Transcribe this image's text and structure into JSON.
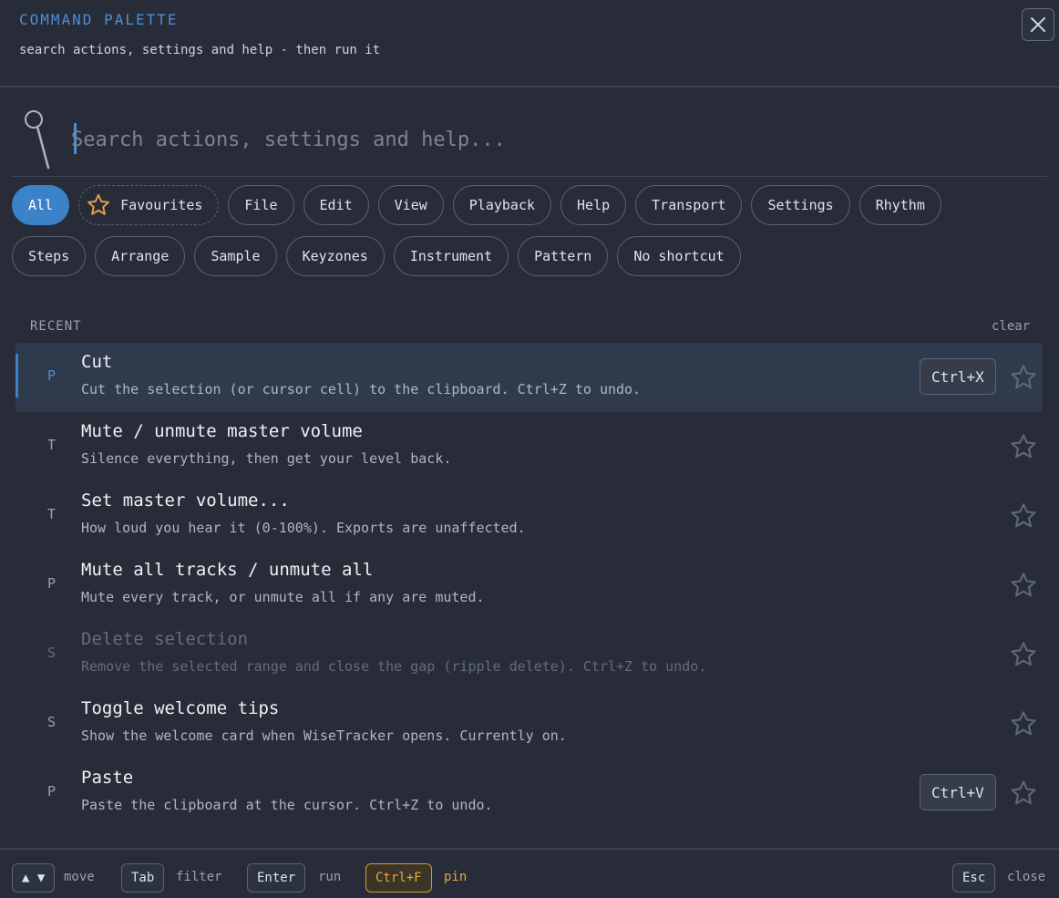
{
  "header": {
    "title": "COMMAND PALETTE",
    "subtitle": "search actions, settings and help - then run it"
  },
  "search": {
    "placeholder": "Search actions, settings and help..."
  },
  "chips_row1": [
    "All",
    "Favourites",
    "File",
    "Edit",
    "View",
    "Playback",
    "Help",
    "Transport",
    "Settings",
    "Rhythm"
  ],
  "chips_row2": [
    "Steps",
    "Arrange",
    "Sample",
    "Keyzones",
    "Instrument",
    "Pattern",
    "No shortcut"
  ],
  "active_chip": "All",
  "section": {
    "label": "RECENT",
    "clear": "clear"
  },
  "commands": [
    {
      "cat": "P",
      "title": "Cut",
      "desc": "Cut the selection (or cursor cell) to the clipboard. Ctrl+Z to undo.",
      "shortcut": "Ctrl+X"
    },
    {
      "cat": "T",
      "title": "Mute / unmute master volume",
      "desc": "Silence everything, then get your level back.",
      "shortcut": ""
    },
    {
      "cat": "T",
      "title": "Set master volume...",
      "desc": "How loud you hear it (0-100%). Exports are unaffected.",
      "shortcut": ""
    },
    {
      "cat": "P",
      "title": "Mute all tracks / unmute all",
      "desc": "Mute every track, or unmute all if any are muted.",
      "shortcut": ""
    },
    {
      "cat": "S",
      "title": "Delete selection",
      "desc": "Remove the selected range and close the gap (ripple delete). Ctrl+Z to undo.",
      "shortcut": ""
    },
    {
      "cat": "S",
      "title": "Toggle welcome tips",
      "desc": "Show the welcome card when WiseTracker opens. Currently on.",
      "shortcut": ""
    },
    {
      "cat": "P",
      "title": "Paste",
      "desc": "Paste the clipboard at the cursor. Ctrl+Z to undo.",
      "shortcut": "Ctrl+V"
    }
  ],
  "footer": {
    "move_key": "▲ ▼",
    "move_label": "move",
    "filter_key": "Tab",
    "filter_label": "filter",
    "run_key": "Enter",
    "run_label": "run",
    "pin_key": "Ctrl+F",
    "pin_label": "pin",
    "close_key": "Esc",
    "close_label": "close"
  },
  "colors": {
    "background": "#272c38",
    "accent": "#3b82c8",
    "pin": "#e9a44a"
  }
}
